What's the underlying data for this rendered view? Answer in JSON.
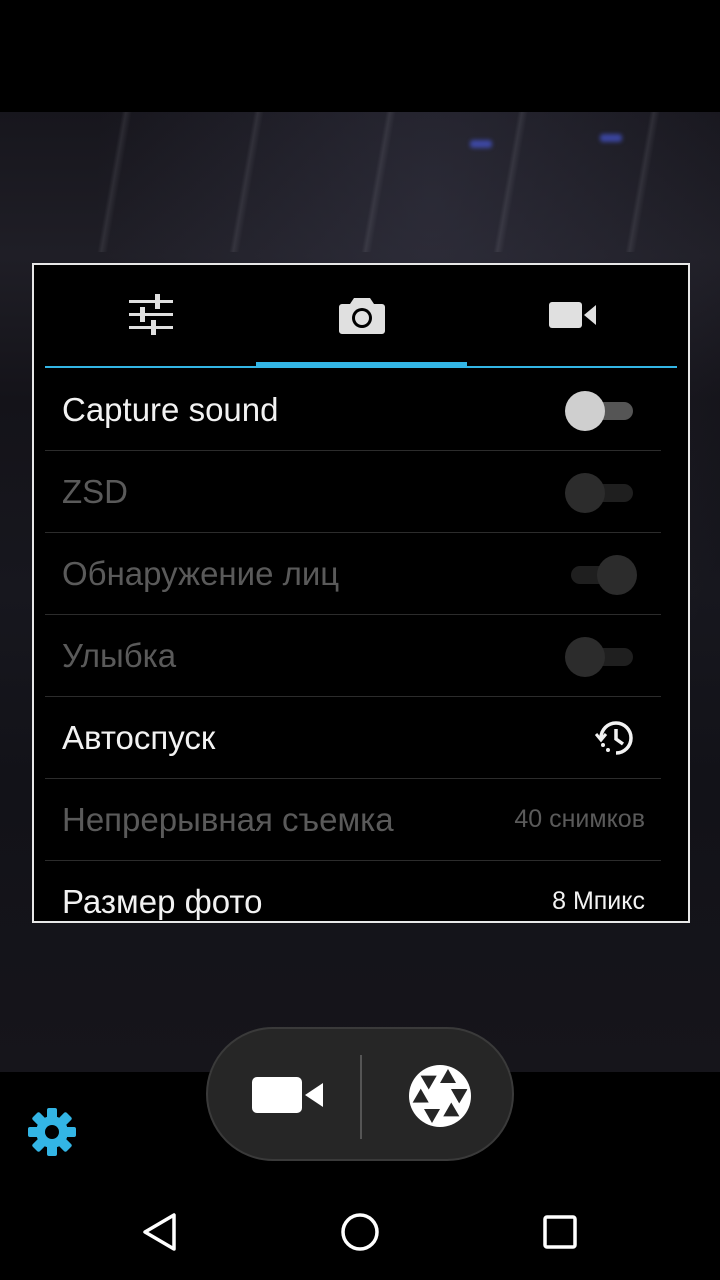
{
  "colors": {
    "accent": "#33b5e5",
    "panel_border": "#e8e8e8",
    "text_enabled": "#f2f2f2",
    "text_disabled": "#5a5a5a",
    "gear": "#33b5e5"
  },
  "settings_panel": {
    "tabs": [
      {
        "icon": "sliders-icon",
        "selected": false
      },
      {
        "icon": "camera-icon",
        "selected": true
      },
      {
        "icon": "video-camera-icon",
        "selected": false
      }
    ],
    "rows": [
      {
        "label": "Capture sound",
        "control": "switch",
        "state": "off",
        "enabled": true
      },
      {
        "label": "ZSD",
        "control": "switch",
        "state": "off",
        "enabled": false
      },
      {
        "label": "Обнаружение лиц",
        "control": "switch",
        "state": "on",
        "enabled": false
      },
      {
        "label": "Улыбка",
        "control": "switch",
        "state": "off",
        "enabled": false
      },
      {
        "label": "Автоспуск",
        "control": "icon",
        "icon": "timer-icon",
        "enabled": true
      },
      {
        "label": "Непрерывная съемка",
        "control": "value",
        "value": "40 снимков",
        "enabled": false
      },
      {
        "label": "Размер фото",
        "control": "value",
        "value": "8 Мпикс",
        "enabled": true
      }
    ]
  },
  "bottom_controls": {
    "mode_switch": {
      "video_icon": "video-camera-icon",
      "shutter_icon": "shutter-icon"
    },
    "settings_icon": "gear-icon"
  },
  "nav_bar": {
    "back_icon": "back-icon",
    "home_icon": "home-icon",
    "recents_icon": "recents-icon"
  }
}
